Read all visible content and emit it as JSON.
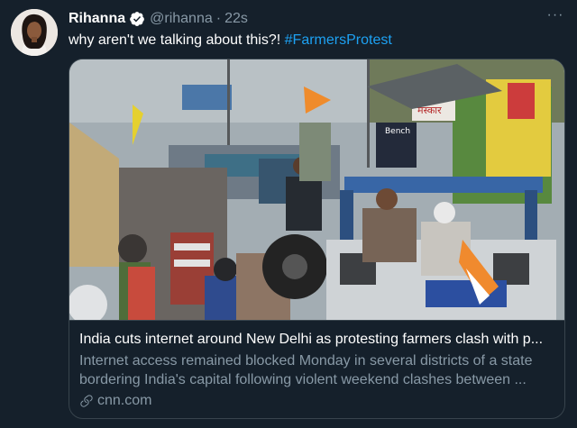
{
  "author": {
    "name": "Rihanna",
    "handle": "@rihanna",
    "separator": "·",
    "time": "22s",
    "verified": true
  },
  "tweet": {
    "text": "why aren't we talking about this?!",
    "hashtag": "#FarmersProtest"
  },
  "more_menu": {
    "glyph": "···"
  },
  "card": {
    "title": "India cuts internet around New Delhi as protesting farmers clash with p...",
    "description_line1": "Internet access remained blocked Monday in several districts of a state",
    "description_line2": "bordering India's capital following violent weekend clashes between ...",
    "domain": "cnn.com",
    "banner_text": "Bench",
    "sign_text": "मस्कार"
  },
  "colors": {
    "background": "#15202b",
    "accent": "#1da1f2",
    "secondary_text": "#8899a6",
    "border": "#38444d"
  },
  "icons": {
    "verified": "verified-badge-icon",
    "more": "more-icon",
    "link": "link-icon"
  }
}
